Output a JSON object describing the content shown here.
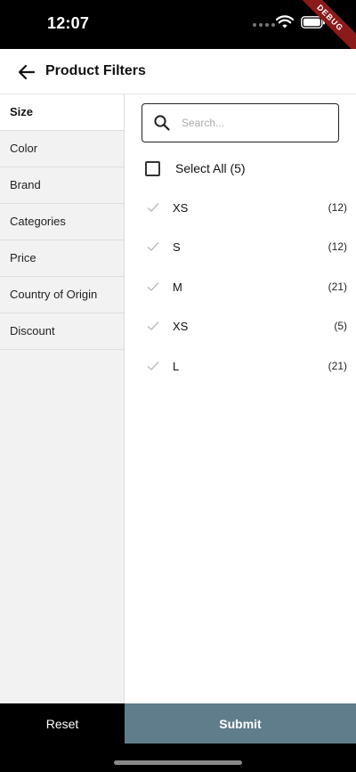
{
  "status_bar": {
    "time": "12:07"
  },
  "debug_banner": "DEBUG",
  "app_bar": {
    "title": "Product Filters"
  },
  "sidebar": {
    "items": [
      {
        "label": "Size",
        "active": true
      },
      {
        "label": "Color"
      },
      {
        "label": "Brand"
      },
      {
        "label": "Categories"
      },
      {
        "label": "Price"
      },
      {
        "label": "Country of Origin"
      },
      {
        "label": "Discount"
      }
    ]
  },
  "search": {
    "placeholder": "Search...",
    "value": ""
  },
  "select_all": {
    "label": "Select All (5)"
  },
  "options": [
    {
      "name": "XS",
      "count": "(12)"
    },
    {
      "name": "S",
      "count": "(12)"
    },
    {
      "name": "M",
      "count": "(21)"
    },
    {
      "name": "XS",
      "count": "(5)"
    },
    {
      "name": "L",
      "count": "(21)"
    }
  ],
  "footer": {
    "reset_label": "Reset",
    "submit_label": "Submit"
  },
  "colors": {
    "submit_bg": "#607d8b",
    "reset_bg": "#000000",
    "sidebar_bg": "#f3f2f3",
    "debug_ribbon": "#8b1a1a"
  }
}
